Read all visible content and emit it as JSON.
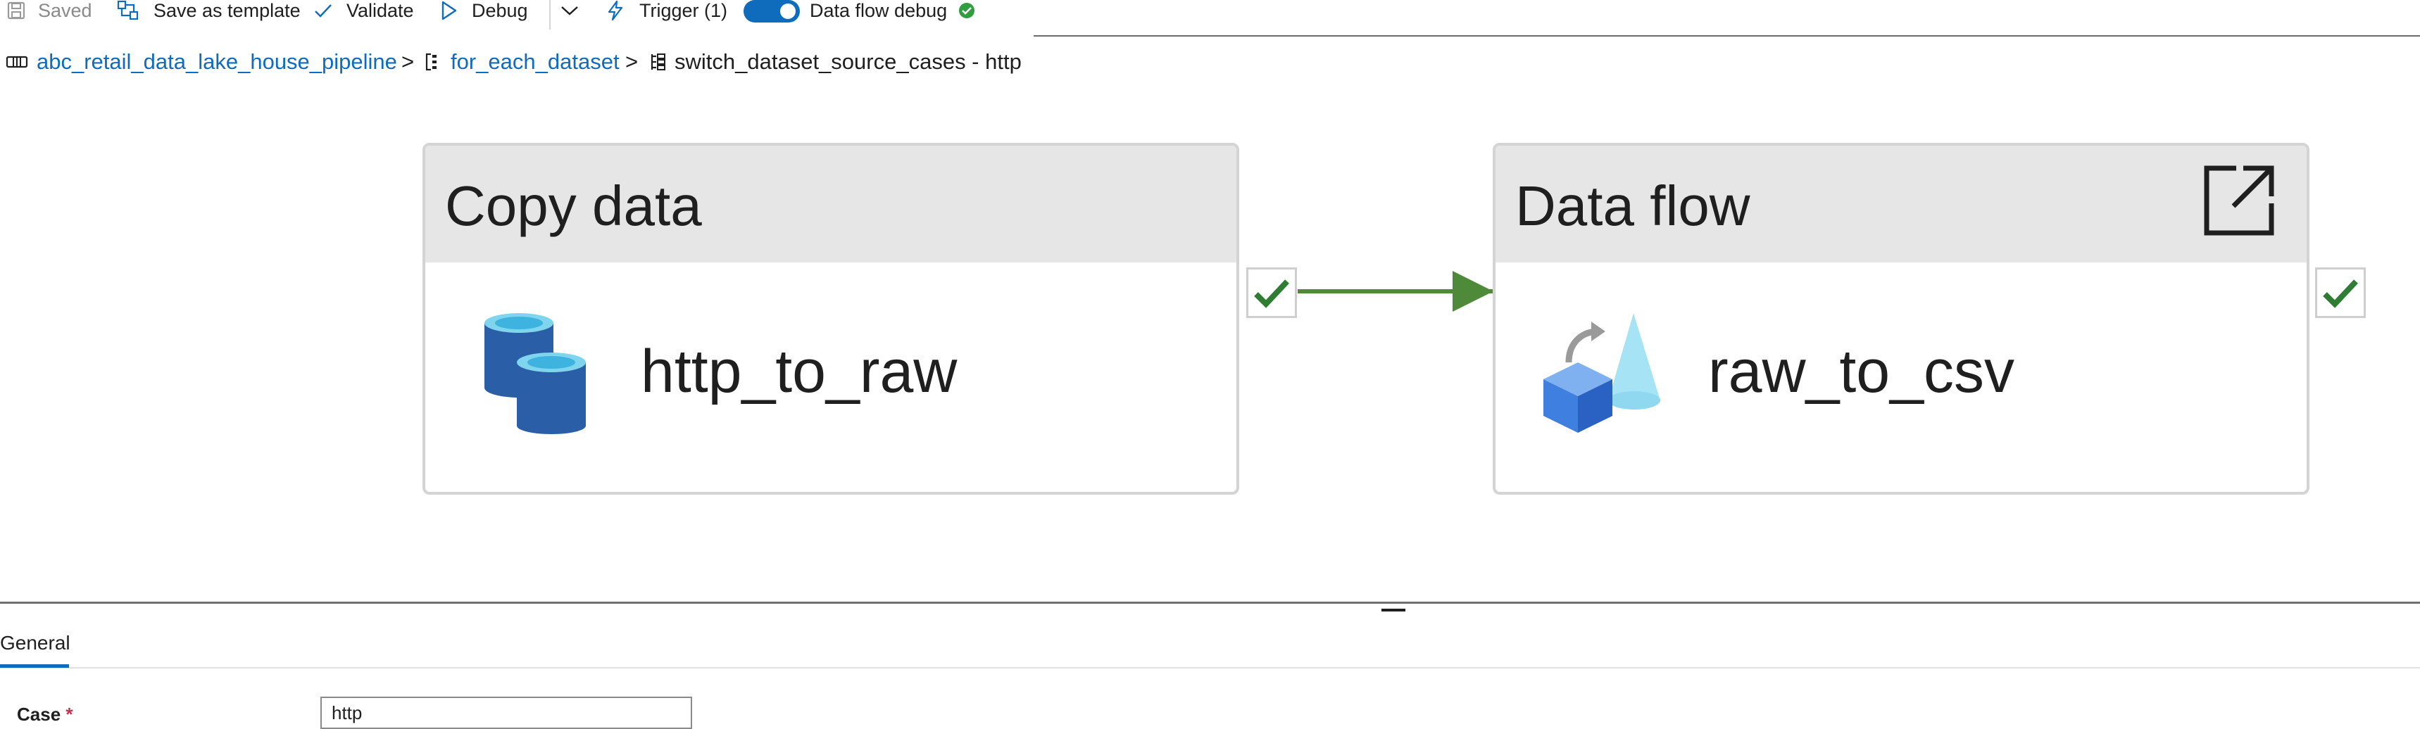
{
  "toolbar": {
    "saved_label": "Saved",
    "save_as_template_label": "Save as template",
    "validate_label": "Validate",
    "debug_label": "Debug",
    "trigger_label": "Trigger (1)",
    "data_flow_debug_label": "Data flow debug",
    "data_flow_debug_on": true
  },
  "breadcrumb": {
    "pipeline": "abc_retail_data_lake_house_pipeline",
    "separator": ">",
    "foreach": "for_each_dataset",
    "current": "switch_dataset_source_cases - http"
  },
  "activities": [
    {
      "type": "Copy data",
      "name": "http_to_raw",
      "icon": "copy-data-icon",
      "status": "succeeded"
    },
    {
      "type": "Data flow",
      "name": "raw_to_csv",
      "icon": "data-flow-icon",
      "status": "succeeded"
    }
  ],
  "panel": {
    "tabs": [
      {
        "label": "General",
        "active": true
      }
    ],
    "case_label": "Case",
    "required_mark": "*",
    "case_value": "http"
  },
  "colors": {
    "accent": "#0f6cbd",
    "success": "#2e7d32",
    "connector": "#4f8a3a",
    "header_bg": "#e6e6e6"
  }
}
